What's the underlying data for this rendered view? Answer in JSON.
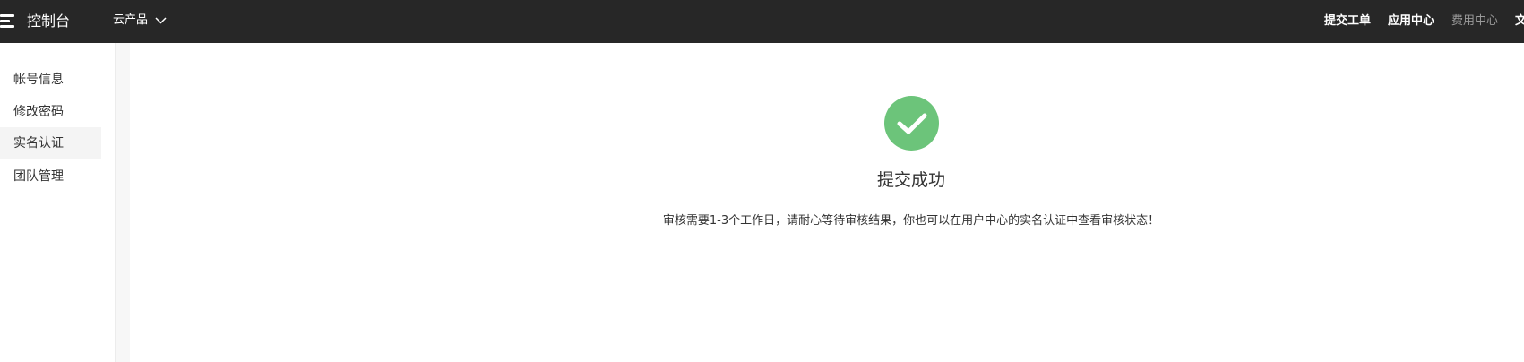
{
  "topbar": {
    "logo_text": "控制台",
    "product_menu": "云产品",
    "links": [
      "提交工单",
      "应用中心",
      "费用中心",
      "文档"
    ]
  },
  "sidebar": {
    "items": [
      "帐号信息",
      "修改密码",
      "实名认证",
      "团队管理"
    ],
    "active_item": "实名认证"
  },
  "result": {
    "title": "提交成功",
    "description": "审核需要1-3个工作日，请耐心等待审核结果，你也可以在用户中心的实名认证中查看审核状态！",
    "icon": "check-circle-icon",
    "icon_color": "#6cc47a"
  },
  "colors": {
    "topbar_bg": "#272727",
    "muted_link": "#9a9a9a"
  }
}
